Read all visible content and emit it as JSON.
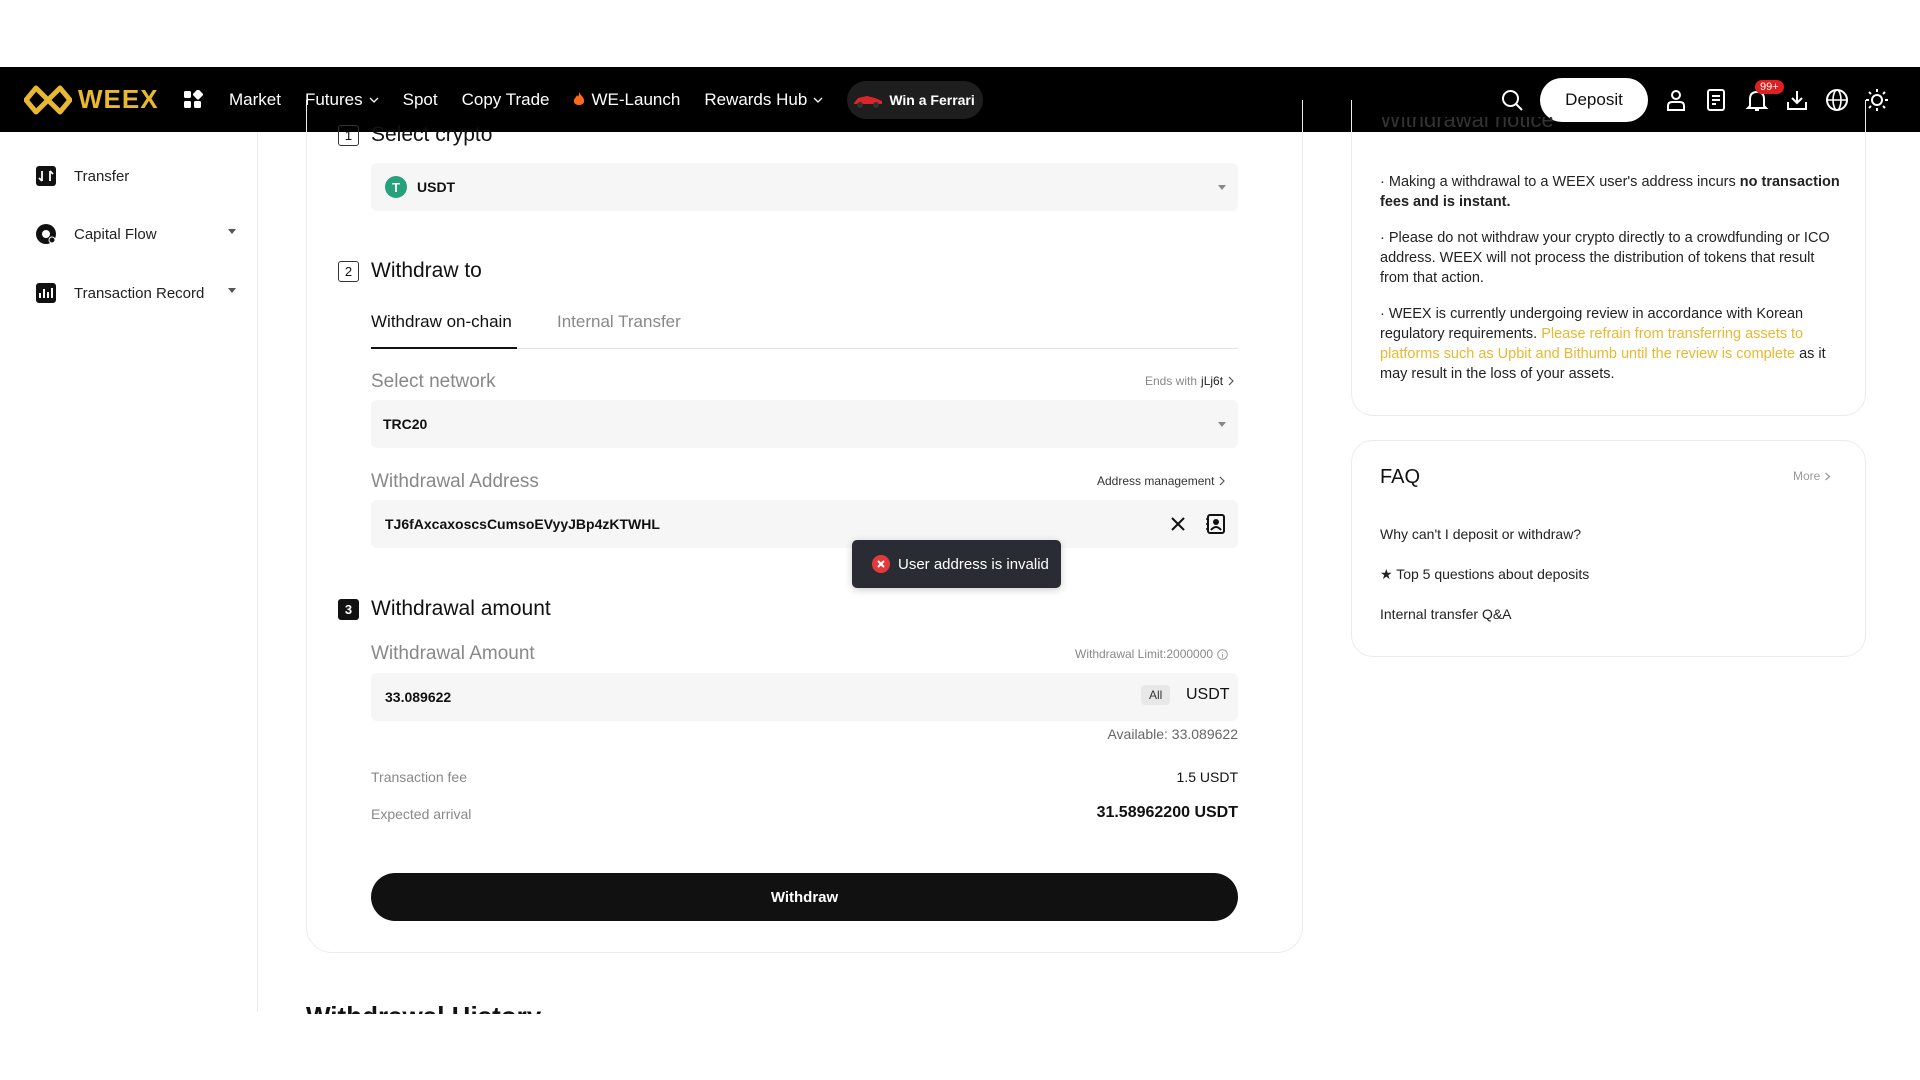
{
  "brand": {
    "name": "WEEX",
    "accent": "#e8b830"
  },
  "nav": {
    "links": [
      {
        "label": "Market"
      },
      {
        "label": "Futures",
        "dropdown": true
      },
      {
        "label": "Spot"
      },
      {
        "label": "Copy Trade"
      },
      {
        "label": "WE-Launch",
        "icon": "flame-icon"
      },
      {
        "label": "Rewards Hub",
        "dropdown": true
      }
    ],
    "promo": "Win a Ferrari",
    "deposit": "Deposit",
    "notifications_badge": "99+"
  },
  "sidebar": {
    "items": [
      {
        "label": "Transfer",
        "icon": "transfer-icon"
      },
      {
        "label": "Capital Flow",
        "icon": "capital-flow-icon",
        "expandable": true
      },
      {
        "label": "Transaction Record",
        "icon": "record-icon",
        "expandable": true
      }
    ]
  },
  "form": {
    "step1": {
      "num": "1",
      "title": "Select crypto",
      "coin": "USDT",
      "coin_glyph": "T"
    },
    "step2": {
      "num": "2",
      "title": "Withdraw to",
      "tabs": [
        "Withdraw on-chain",
        "Internal Transfer"
      ],
      "network_label": "Select network",
      "network_hint_prefix": "Ends with",
      "network_hint_value": "jLj6t",
      "network": "TRC20",
      "address_label": "Withdrawal Address",
      "address_mgmt": "Address management",
      "address": "TJ6fAxcaxoscsCumsoEVyyJBp4zKTWHL"
    },
    "step3": {
      "num": "3",
      "title": "Withdrawal amount",
      "amount_label": "Withdrawal Amount",
      "limit": "Withdrawal Limit:2000000",
      "amount": "33.089622",
      "all": "All",
      "unit": "USDT",
      "available": "Available: 33.089622",
      "fee_label": "Transaction fee",
      "fee": "1.5 USDT",
      "arrival_label": "Expected arrival",
      "arrival": "31.58962200 USDT"
    },
    "submit": "Withdraw",
    "toast": "User address is invalid"
  },
  "notice": {
    "title_cut": "Withdrawal notice",
    "items": [
      {
        "pre": "Making a withdrawal to a WEEX user's address incurs ",
        "bold": "no transaction fees and is instant."
      },
      {
        "pre": "Please do not withdraw your crypto directly to a crowdfunding or ICO address. WEEX will not process the distribution of tokens that result from that action."
      },
      {
        "pre": "WEEX is currently undergoing review in accordance with Korean regulatory requirements. ",
        "highlight": "Please refrain from transferring assets to platforms such as Upbit and Bithumb until the review is complete",
        "post": " as it may result in the loss of your assets."
      }
    ]
  },
  "faq": {
    "title": "FAQ",
    "more": "More",
    "items": [
      "Why can't I deposit or withdraw?",
      "★ Top 5 questions about deposits",
      "Internal transfer Q&A"
    ]
  },
  "history_heading_cut": "Withdrawal History"
}
